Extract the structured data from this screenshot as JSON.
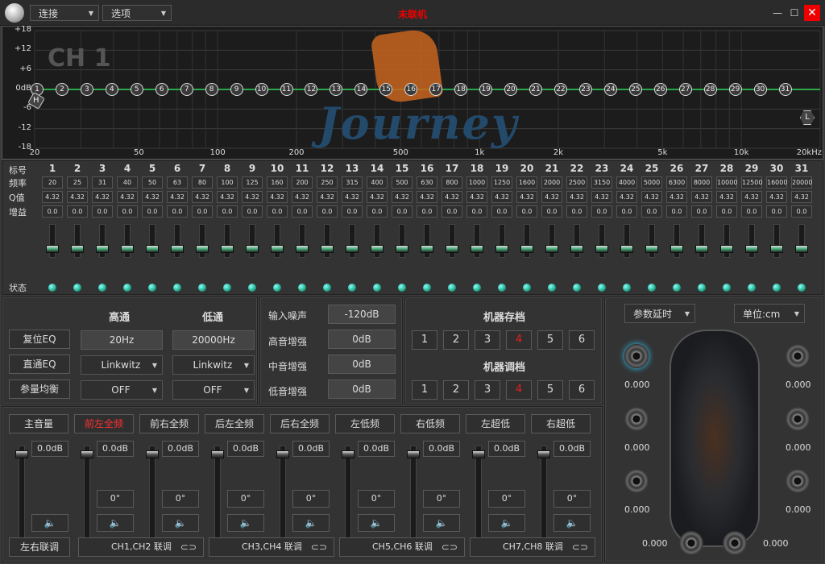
{
  "titlebar": {
    "connect": "连接",
    "options": "选项",
    "status": "未联机"
  },
  "eq": {
    "y_labels": [
      "+18",
      "+12",
      "+6",
      "0dB",
      "-6",
      "-12",
      "-18"
    ],
    "x_labels": [
      "20",
      "50",
      "100",
      "200",
      "500",
      "1k",
      "2k",
      "5k",
      "10k",
      "20kHz"
    ],
    "channel_label": "CH 1",
    "brand": "Journey",
    "band_points": [
      "1",
      "2",
      "3",
      "4",
      "5",
      "6",
      "7",
      "8",
      "9",
      "10",
      "11",
      "12",
      "13",
      "14",
      "15",
      "16",
      "17",
      "18",
      "19",
      "20",
      "21",
      "22",
      "23",
      "24",
      "25",
      "26",
      "27",
      "28",
      "29",
      "30",
      "31"
    ],
    "hpf_marker": "H",
    "lpf_marker": "L"
  },
  "bands": {
    "labels": {
      "index": "标号",
      "freq": "频率",
      "q": "Q值",
      "gain": "增益",
      "state": "状态"
    },
    "numbers": [
      "1",
      "2",
      "3",
      "4",
      "5",
      "6",
      "7",
      "8",
      "9",
      "10",
      "11",
      "12",
      "13",
      "14",
      "15",
      "16",
      "17",
      "18",
      "19",
      "20",
      "21",
      "22",
      "23",
      "24",
      "25",
      "26",
      "27",
      "28",
      "29",
      "30",
      "31"
    ],
    "freqs": [
      "20",
      "25",
      "31",
      "40",
      "50",
      "63",
      "80",
      "100",
      "125",
      "160",
      "200",
      "250",
      "315",
      "400",
      "500",
      "630",
      "800",
      "1000",
      "1250",
      "1600",
      "2000",
      "2500",
      "3150",
      "4000",
      "5000",
      "6300",
      "8000",
      "10000",
      "12500",
      "16000",
      "20000"
    ],
    "q": "4.32",
    "gain": "0.0"
  },
  "filters": {
    "reset_eq": "复位EQ",
    "bypass_eq": "直通EQ",
    "param_eq": "参量均衡",
    "hp_title": "高通",
    "lp_title": "低通",
    "hp_freq": "20Hz",
    "lp_freq": "20000Hz",
    "hp_type": "Linkwitz",
    "lp_type": "Linkwitz",
    "hp_slope": "OFF",
    "lp_slope": "OFF"
  },
  "noise": {
    "input_noise_label": "输入噪声",
    "input_noise": "-120dB",
    "treble_label": "高音增强",
    "treble": "0dB",
    "mid_label": "中音增强",
    "mid": "0dB",
    "bass_label": "低音增强",
    "bass": "0dB"
  },
  "presets": {
    "save_title": "机器存档",
    "load_title": "机器调档",
    "slots": [
      "1",
      "2",
      "3",
      "4",
      "5",
      "6"
    ],
    "active_color": "#e02020"
  },
  "delay": {
    "mode": "参数延时",
    "unit": "单位:cm",
    "values": [
      "0.000",
      "0.000",
      "0.000",
      "0.000",
      "0.000",
      "0.000",
      "0.000",
      "0.000",
      "0.000",
      "0.000"
    ]
  },
  "mixer": {
    "channels": [
      "主音量",
      "前左全频",
      "前右全频",
      "后左全频",
      "后右全频",
      "左低频",
      "右低频",
      "左超低",
      "右超低"
    ],
    "level": "0.0dB",
    "phase": "0°",
    "link_lr": "左右联调",
    "links": [
      "CH1,CH2 联调",
      "CH3,CH4 联调",
      "CH5,CH6 联调",
      "CH7,CH8 联调"
    ]
  }
}
